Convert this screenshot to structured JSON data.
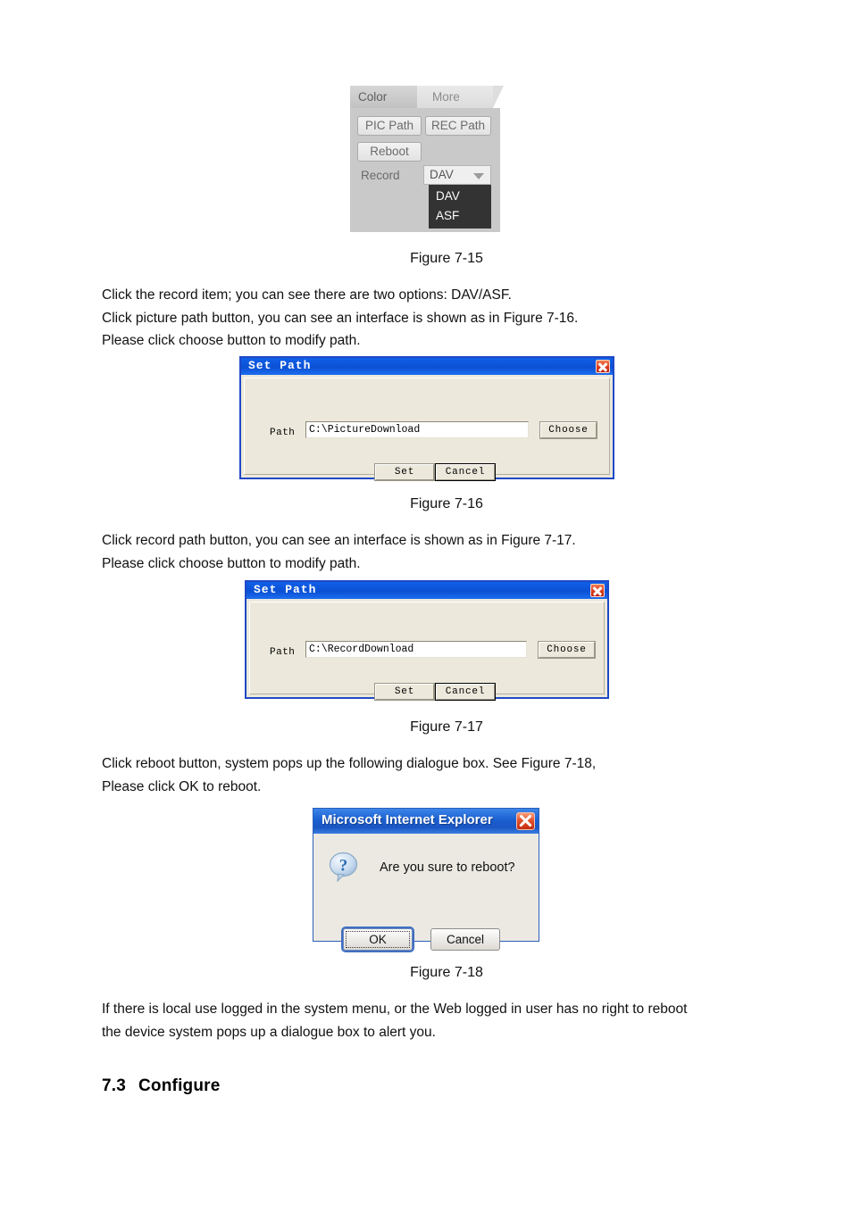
{
  "document": {
    "figure_715": {
      "caption": "Figure 7-15",
      "tabs": [
        {
          "label": "Color",
          "active": true
        },
        {
          "label": "More",
          "active": false
        }
      ],
      "buttons": {
        "pic_path": "PIC Path",
        "rec_path": "REC Path",
        "reboot": "Reboot"
      },
      "record_label": "Record",
      "record_combo_value": "DAV",
      "record_options": [
        "DAV",
        "ASF"
      ],
      "colors": {
        "panel_bg": "#c9c9c9",
        "dropdown_bg": "#333333",
        "dropdown_text": "#ffffff",
        "tab_text": "#5e5e5e"
      }
    },
    "paragraph_1": "Click the record item; you can see there are two options: DAV/ASF.\nClick picture path button, you can see an interface is shown as in Figure 7-16.\nPlease click choose button to modify path.",
    "figure_716": {
      "caption": "Figure 7-16",
      "dialog": {
        "title": "Set Path",
        "close_icon": "close-icon",
        "path_label": "Path",
        "path_value": "C:\\PictureDownload",
        "choose_button": "Choose",
        "set_button": "Set",
        "cancel_button": "Cancel",
        "colors": {
          "titlebar": "#0b50d4",
          "body": "#ece9dc",
          "border": "#1f49c6",
          "close_button": "#d8391c"
        }
      }
    },
    "paragraph_2": "Click record path button, you can see an interface is shown as in Figure 7-17.\nPlease click choose button to modify path.",
    "figure_717": {
      "caption": "Figure 7-17",
      "dialog": {
        "title": "Set Path",
        "close_icon": "close-icon",
        "path_label": "Path",
        "path_value": "C:\\RecordDownload",
        "choose_button": "Choose",
        "set_button": "Set",
        "cancel_button": "Cancel"
      }
    },
    "paragraph_3": "Click reboot button, system pops up the following dialogue box. See Figure 7-18,\nPlease click OK to reboot.",
    "figure_718": {
      "caption": "Figure 7-18",
      "dialog": {
        "title": "Microsoft Internet Explorer",
        "close_icon": "close-icon",
        "icon": "question-bubble-icon",
        "message": "Are you sure to reboot?",
        "ok_button": "OK",
        "cancel_button": "Cancel",
        "colors": {
          "titlebar": "#1b5fd2",
          "body": "#ebe9e2",
          "close_button": "#e5512c",
          "icon": "#3b7ac4"
        }
      }
    },
    "paragraph_4": "If there is local use logged in the system menu, or the Web logged in user has no right to reboot\nthe device system pops up a dialogue box to alert you.",
    "section_heading": {
      "number": "7.3",
      "title": "Configure"
    }
  }
}
